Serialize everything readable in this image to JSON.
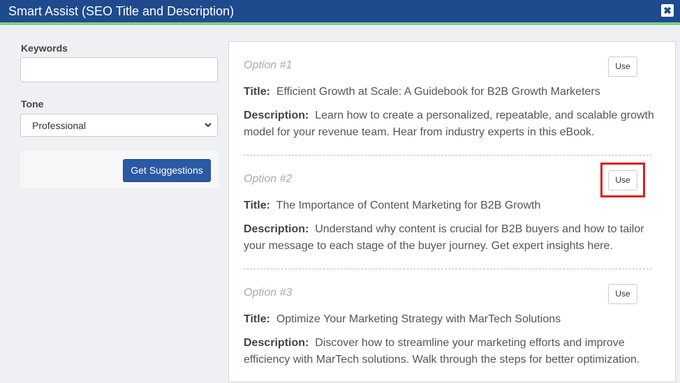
{
  "dialog": {
    "title": "Smart Assist (SEO Title and Description)",
    "close_icon": "✖"
  },
  "form": {
    "keywords_label": "Keywords",
    "keywords_value": "",
    "tone_label": "Tone",
    "tone_value": "Professional",
    "get_suggestions_label": "Get Suggestions"
  },
  "options": [
    {
      "label": "Option #1",
      "use_label": "Use",
      "title_label": "Title:",
      "title": "Efficient Growth at Scale: A Guidebook for B2B Growth Marketers",
      "description_label": "Description:",
      "description": "Learn how to create a personalized, repeatable, and scalable growth model for your revenue team. Hear from industry experts in this eBook."
    },
    {
      "label": "Option #2",
      "use_label": "Use",
      "title_label": "Title:",
      "title": "The Importance of Content Marketing for B2B Growth",
      "description_label": "Description:",
      "description": "Understand why content is crucial for B2B buyers and how to tailor your message to each stage of the buyer journey. Get expert insights here."
    },
    {
      "label": "Option #3",
      "use_label": "Use",
      "title_label": "Title:",
      "title": "Optimize Your Marketing Strategy with MarTech Solutions",
      "description_label": "Description:",
      "description": "Discover how to streamline your marketing efforts and improve efficiency with MarTech solutions. Walk through the steps for better optimization."
    }
  ],
  "colors": {
    "header_bg": "#1f4a8e",
    "accent_bar": "#7ed08d",
    "primary_button": "#2a5aa5",
    "highlight_box": "#e01b24"
  }
}
